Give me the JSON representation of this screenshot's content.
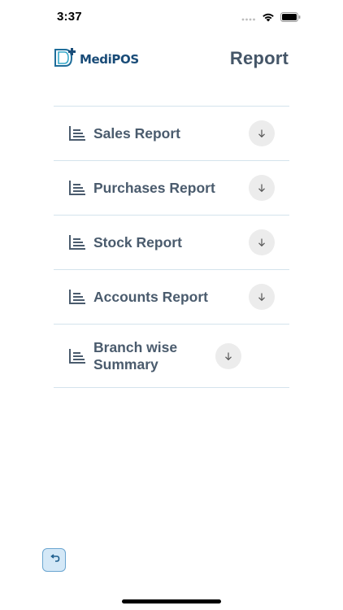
{
  "status_bar": {
    "time": "3:37",
    "icons": [
      "signal-icon",
      "wifi-icon",
      "battery-icon"
    ]
  },
  "header": {
    "logo_text": "MediPOS",
    "title": "Report"
  },
  "reports": [
    {
      "label": "Sales Report",
      "icon": "report-list-icon",
      "action_icon": "download-arrow-icon"
    },
    {
      "label": "Purchases Report",
      "icon": "report-list-icon",
      "action_icon": "download-arrow-icon"
    },
    {
      "label": "Stock Report",
      "icon": "report-list-icon",
      "action_icon": "download-arrow-icon"
    },
    {
      "label": "Accounts Report",
      "icon": "report-list-icon",
      "action_icon": "download-arrow-icon"
    },
    {
      "label": "Branch wise Summary",
      "icon": "report-list-icon",
      "action_icon": "download-arrow-icon"
    }
  ],
  "footer": {
    "undo_icon": "undo-icon"
  },
  "colors": {
    "title": "#455668",
    "row_text": "#4a5b6d",
    "divider": "#d4e3ec",
    "logo": "#1a4c78",
    "undo_bg": "#d4e8f7",
    "undo_border": "#6aa5d0"
  }
}
